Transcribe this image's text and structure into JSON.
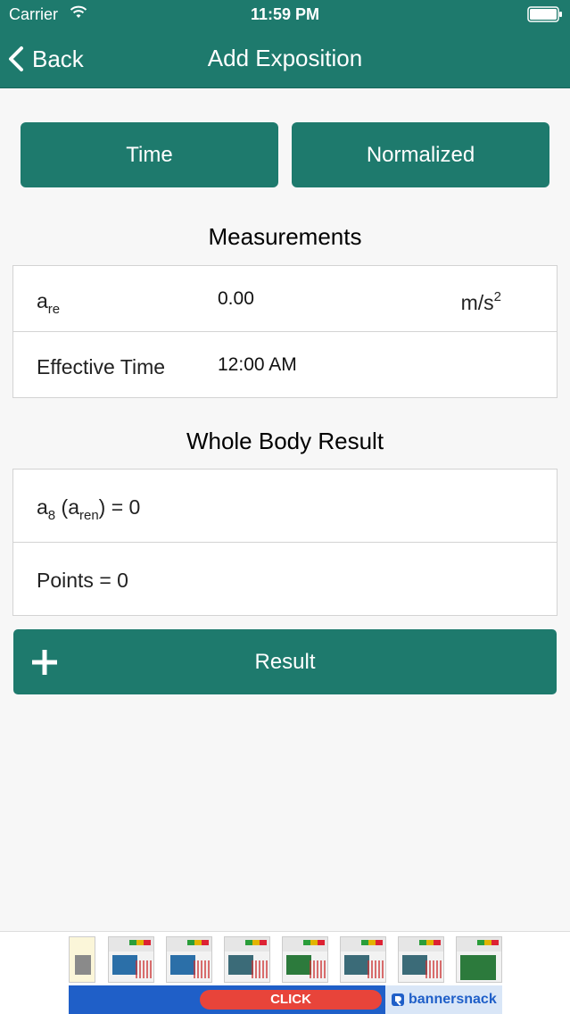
{
  "status_bar": {
    "carrier": "Carrier",
    "time": "11:59 PM"
  },
  "nav": {
    "back_label": "Back",
    "title": "Add Exposition"
  },
  "segments": {
    "time_label": "Time",
    "normalized_label": "Normalized"
  },
  "measurements": {
    "title": "Measurements",
    "rows": [
      {
        "label_main": "a",
        "label_sub": "re",
        "value": "0.00",
        "unit_main": "m/s",
        "unit_sup": "2"
      },
      {
        "label": "Effective Time",
        "value": "12:00 AM"
      }
    ]
  },
  "whole_body": {
    "title": "Whole Body Result",
    "a8_main": "a",
    "a8_sub": "8",
    "a8_open": " (a",
    "a8_sub2": "ren",
    "a8_close": ") = 0",
    "points": "Points = 0"
  },
  "result_button": {
    "label": "Result"
  },
  "ad": {
    "click_label": "CLICK",
    "brand": "bannersnack"
  },
  "colors": {
    "accent": "#1e7a6d",
    "background": "#f7f7f7"
  },
  "icons": [
    "wifi-icon",
    "battery-icon",
    "back-chevron-icon",
    "plus-icon"
  ]
}
